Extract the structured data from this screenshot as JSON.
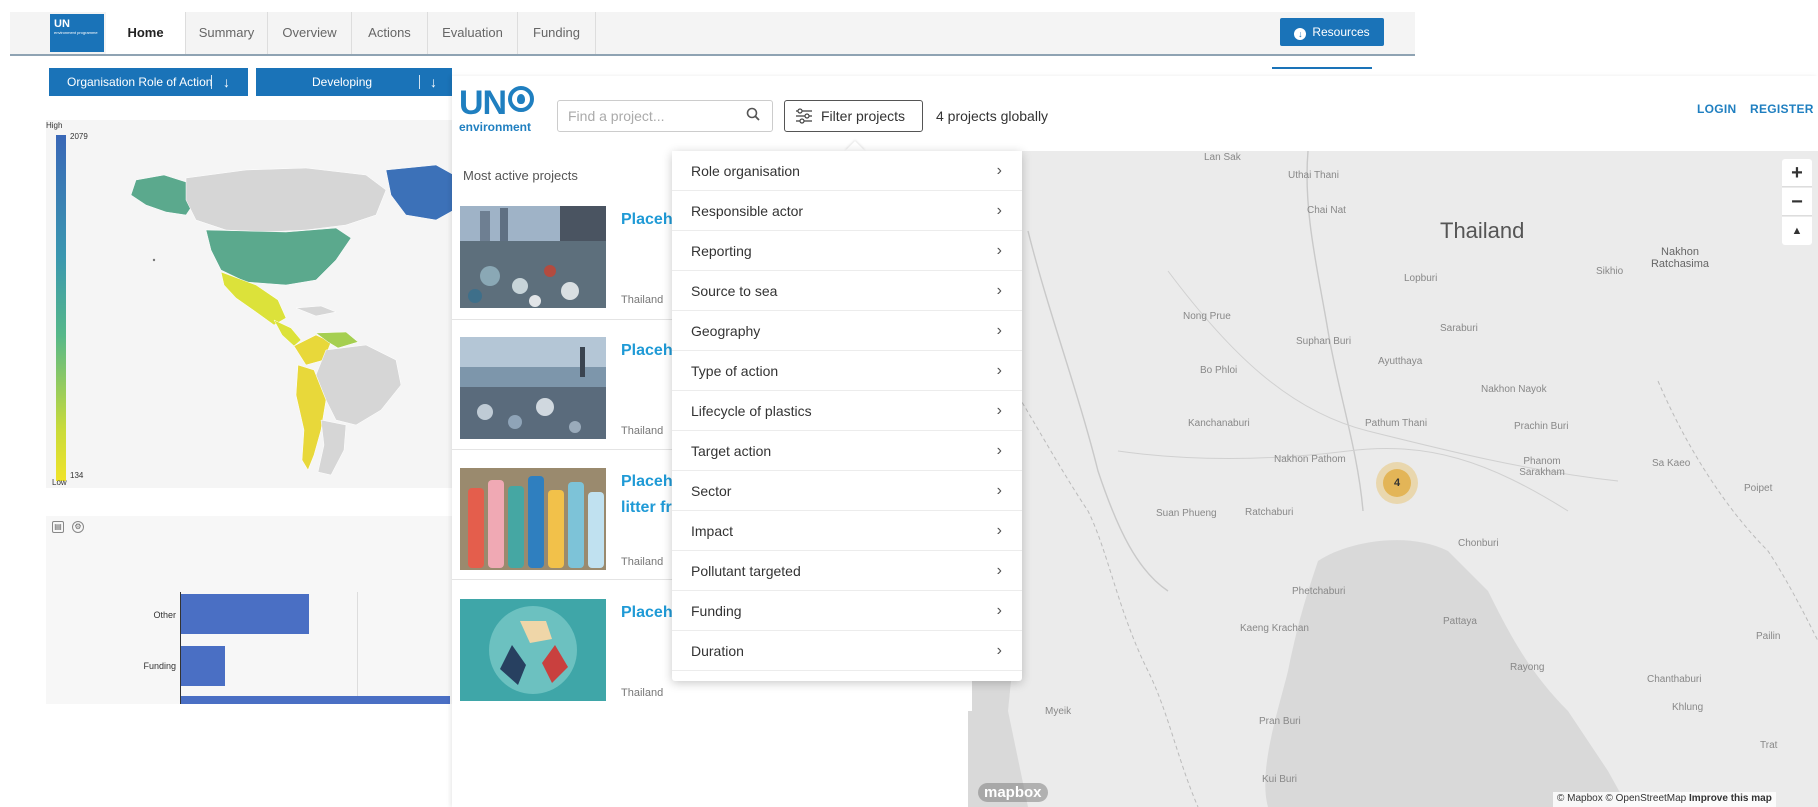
{
  "dashboard": {
    "logo": {
      "text": "UN",
      "subtitle": "environment programme"
    },
    "tabs": [
      "Home",
      "Summary",
      "Overview",
      "Actions",
      "Evaluation",
      "Funding"
    ],
    "active_tab": "Home",
    "resources_label": "Resources",
    "selects": [
      {
        "label": "Organisation Role of Action"
      },
      {
        "label": "Developing"
      }
    ],
    "legend": {
      "high": "High",
      "high_value": "2079",
      "low": "Low",
      "low_value": "134"
    },
    "bar_chart": {
      "categories": [
        "Other",
        "Funding"
      ],
      "values": [
        0.71,
        0.2
      ]
    }
  },
  "platform": {
    "logo": {
      "un": "UN",
      "environment": "environment"
    },
    "search": {
      "placeholder": "Find a project..."
    },
    "filter_label": "Filter projects",
    "project_count": "4 projects globally",
    "login": "LOGIN",
    "register": "REGISTER",
    "most_active": "Most active projects",
    "projects": [
      {
        "title": "Placeh",
        "country": "Thailand"
      },
      {
        "title": "Placeh",
        "country": "Thailand"
      },
      {
        "title": "Placeh",
        "title2": "litter fr",
        "country": "Thailand"
      },
      {
        "title": "Placeh",
        "country": "Thailand"
      }
    ],
    "filter_menu": [
      "Role organisation",
      "Responsible actor",
      "Reporting",
      "Source to sea",
      "Geography",
      "Type of action",
      "Lifecycle of plastics",
      "Target action",
      "Sector",
      "Impact",
      "Pollutant targeted",
      "Funding",
      "Duration"
    ]
  },
  "map": {
    "country": "Thailand",
    "cluster_count": "4",
    "labels": [
      "Lan Sak",
      "Uthai Thani",
      "Chai Nat",
      "Lopburi",
      "Sikhio",
      "Nakhon Ratchasima",
      "Nong Prue",
      "Suphan Buri",
      "Saraburi",
      "Bo Phloi",
      "Ayutthaya",
      "Nakhon Nayok",
      "Kanchanaburi",
      "Pathum Thani",
      "Prachin Buri",
      "Nakhon Pathom",
      "Phanom Sarakham",
      "Sa Kaeo",
      "Suan Phueng",
      "Ratchaburi",
      "Chonburi",
      "Phetchaburi",
      "Kaeng Krachan",
      "Pattaya",
      "Rayong",
      "Chanthaburi",
      "Pran Buri",
      "Kui Buri",
      "Khlung",
      "Trat",
      "Pailin",
      "Poipet",
      "Myeik"
    ],
    "zoom_in": "+",
    "zoom_out": "−",
    "compass": "▲",
    "mapbox_logo": "mapbox",
    "attribution": "© Mapbox © OpenStreetMap",
    "improve": "Improve this map"
  },
  "colors": {
    "unep_blue": "#1a73b8",
    "link_blue": "#1f9ad6",
    "cluster": "#e3b557",
    "bar": "#4a6fc4"
  }
}
